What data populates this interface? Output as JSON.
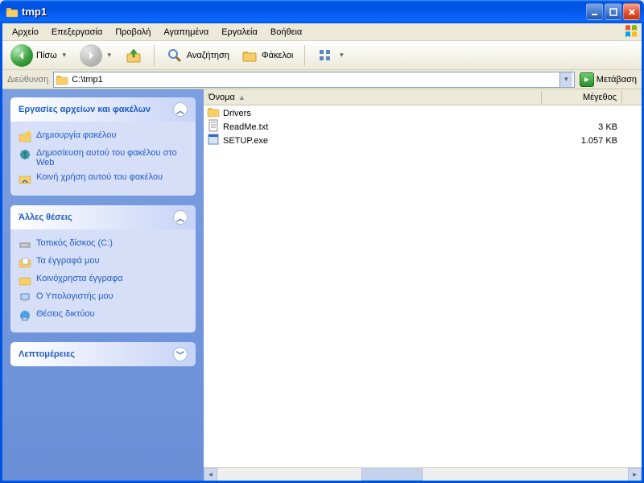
{
  "window": {
    "title": "tmp1"
  },
  "menu": {
    "file": "Αρχείο",
    "edit": "Επεξεργασία",
    "view": "Προβολή",
    "favorites": "Αγαπημένα",
    "tools": "Εργαλεία",
    "help": "Βοήθεια"
  },
  "toolbar": {
    "back": "Πίσω",
    "search": "Αναζήτηση",
    "folders": "Φάκελοι"
  },
  "addressbar": {
    "label": "Διεύθυνση",
    "path": "C:\\tmp1",
    "go": "Μετάβαση"
  },
  "sidebar": {
    "tasks": {
      "title": "Εργασίες αρχείων και φακέλων",
      "new_folder": "Δημιουργία φακέλου",
      "publish_web": "Δημοσίευση αυτού του φακέλου στο Web",
      "share": "Κοινή χρήση αυτού του φακέλου"
    },
    "places": {
      "title": "Άλλες θέσεις",
      "local_disk": "Τοπικός δίσκος (C:)",
      "my_docs": "Τα έγγραφά μου",
      "shared_docs": "Κοινόχρηστα έγγραφα",
      "my_computer": "Ο Υπολογιστής μου",
      "network": "Θέσεις δικτύου"
    },
    "details": {
      "title": "Λεπτομέρειες"
    }
  },
  "columns": {
    "name": "Όνομα",
    "size": "Μέγεθος"
  },
  "files": [
    {
      "name": "Drivers",
      "size": "",
      "type": "folder"
    },
    {
      "name": "ReadMe.txt",
      "size": "3 KB",
      "type": "txt"
    },
    {
      "name": "SETUP.exe",
      "size": "1.057 KB",
      "type": "exe"
    }
  ]
}
